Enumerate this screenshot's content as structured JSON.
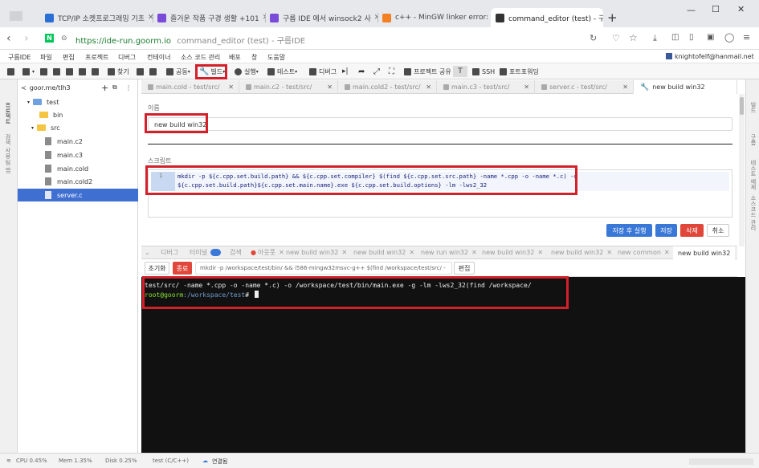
{
  "browser": {
    "tabs": [
      {
        "title": "TCP/IP 소켓프로그래밍 기초",
        "color": "#2b6fd6"
      },
      {
        "title": "즐거운 작품 구경 생활 +101",
        "color": "#7a4ad9"
      },
      {
        "title": "구름 IDE 에서 winsock2 사",
        "color": "#7a4ad9"
      },
      {
        "title": "c++ - MinGW linker error:",
        "color": "#f48024"
      },
      {
        "title": "command_editor (test) - 구",
        "color": "#333333"
      }
    ],
    "new_tab": "+",
    "url_host": "https://ide-run.goorm.io",
    "url_title": "command_editor (test) - 구름IDE",
    "window_controls": {
      "minimize": "—",
      "maximize": "☐",
      "close": "✕"
    }
  },
  "menu": {
    "items": [
      "구름IDE",
      "파일",
      "편집",
      "프로젝트",
      "디버그",
      "컨테이너",
      "소스 코드 관리",
      "배포",
      "창",
      "도움말"
    ],
    "user": "knightofelf@hanmail.net"
  },
  "toolbar": {
    "find": "찾기",
    "share": "공동",
    "build": "빌드",
    "run": "실행",
    "test": "테스트",
    "debug": "디버그",
    "project_share": "프로젝트 공유",
    "ssh": "SSH",
    "portforward": "포트포워딩"
  },
  "explorer": {
    "path": "goor.me/tlh3",
    "tree": [
      {
        "label": "test",
        "type": "folder"
      },
      {
        "label": "bin",
        "type": "folder"
      },
      {
        "label": "src",
        "type": "folder"
      },
      {
        "label": "main.c2",
        "type": "file"
      },
      {
        "label": "main.c3",
        "type": "file"
      },
      {
        "label": "main.cold",
        "type": "file"
      },
      {
        "label": "main.cold2",
        "type": "file"
      },
      {
        "label": "server.c",
        "type": "file"
      }
    ]
  },
  "left_strip": [
    "프로젝트",
    "검색 사용",
    "팀 앱"
  ],
  "right_strip": [
    "빌드",
    "구름",
    "테스트 예제",
    "소스코드 관리"
  ],
  "editor_tabs": [
    "main.cold - test/src/",
    "main.c2 - test/src/",
    "main.cold2 - test/src/",
    "main.c3 - test/src/",
    "server.c - test/src/",
    "new build win32"
  ],
  "command_editor": {
    "name_label": "이름",
    "name_value": "new build win32",
    "script_label": "스크립트",
    "line_no": "1",
    "script_line1": "mkdir -p ${c.cpp.set.build.path} && ${c.cpp.set.compiler} $(find ${c.cpp.set.src.path} -name *.cpp -o -name *.c) -o",
    "script_line2": "${c.cpp.set.build.path}${c.cpp.set.main.name}.exe ${c.cpp.set.build.options} -lm -lws2_32",
    "buttons": {
      "save_run": "저장 후 실행",
      "save": "저장",
      "delete": "삭제",
      "cancel": "취소"
    }
  },
  "bottom_tabs": {
    "debug": "디버그",
    "terminal": "터미널",
    "search": "검색",
    "output": "아웃풋",
    "tabs": [
      "new build win32",
      "new build win32",
      "new run win32",
      "new build win32",
      "new build win32",
      "new common",
      "new build win32"
    ]
  },
  "terminal_bar": {
    "reset": "초기화",
    "stop": "종료",
    "command": "mkdir -p /workspace/test/bin/ && i586-mingw32msvc-g++ $(find /workspace/test/src/ -",
    "edit": "편집"
  },
  "terminal": {
    "line1": "test/src/ -name *.cpp -o -name *.c) -o /workspace/test/bin/main.exe -g -lm -lws2_32(find /workspace/",
    "prompt_user": "root@goorm",
    "prompt_path": ":/workspace/test",
    "prompt_end": "#"
  },
  "status": {
    "cpu": "CPU 0.45%",
    "mem": "Mem 1.35%",
    "disk": "Disk 0.25%",
    "project": "test (C/C++)",
    "connected": "연결됨"
  },
  "colors": {
    "highlight": "#d4202a",
    "accent": "#3f6fd1",
    "danger": "#e0473a"
  }
}
